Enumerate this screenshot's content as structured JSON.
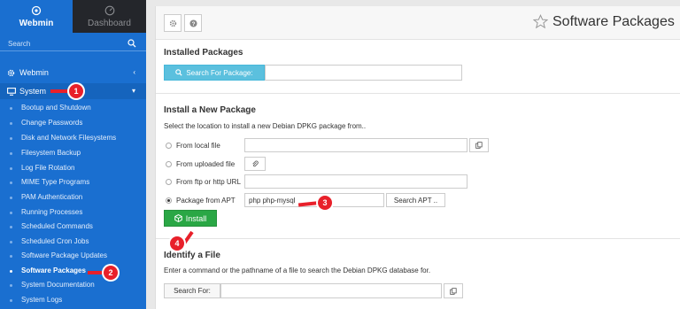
{
  "sidebar": {
    "tabs": [
      {
        "label": "Webmin",
        "icon": "webmin-logo-icon"
      },
      {
        "label": "Dashboard",
        "icon": "dashboard-gauge-icon"
      }
    ],
    "search_placeholder": "Search",
    "menu": [
      {
        "label": "Webmin",
        "icon": "gear-icon"
      },
      {
        "label": "System",
        "icon": "monitor-icon"
      }
    ],
    "submenu": [
      "Bootup and Shutdown",
      "Change Passwords",
      "Disk and Network Filesystems",
      "Filesystem Backup",
      "Log File Rotation",
      "MIME Type Programs",
      "PAM Authentication",
      "Running Processes",
      "Scheduled Commands",
      "Scheduled Cron Jobs",
      "Software Package Updates",
      "Software Packages",
      "System Documentation",
      "System Logs"
    ],
    "active_submenu": "Software Packages"
  },
  "header": {
    "title": "Software Packages"
  },
  "installed": {
    "title": "Installed Packages",
    "search_button": "Search For Package:",
    "search_value": ""
  },
  "install_new": {
    "title": "Install a New Package",
    "description": "Select the location to install a new Debian DPKG package from..",
    "options": [
      {
        "label": "From local file",
        "value": ""
      },
      {
        "label": "From uploaded file",
        "value": ""
      },
      {
        "label": "From ftp or http URL",
        "value": ""
      },
      {
        "label": "Package from APT",
        "value": "php php-mysql"
      }
    ],
    "selected_option": "Package from APT",
    "search_apt_button": "Search APT ..",
    "install_button": "Install"
  },
  "identify": {
    "title": "Identify a File",
    "description": "Enter a command or the pathname of a file to search the Debian DPKG database for.",
    "search_label": "Search For:",
    "search_value": ""
  },
  "callouts": [
    "1",
    "2",
    "3",
    "4"
  ],
  "colors": {
    "sidebar": "#1a6fd0",
    "topbar_dark": "#24262b",
    "callout": "#e8202a",
    "install_green": "#2aa745",
    "search_blue": "#5bc0de"
  }
}
